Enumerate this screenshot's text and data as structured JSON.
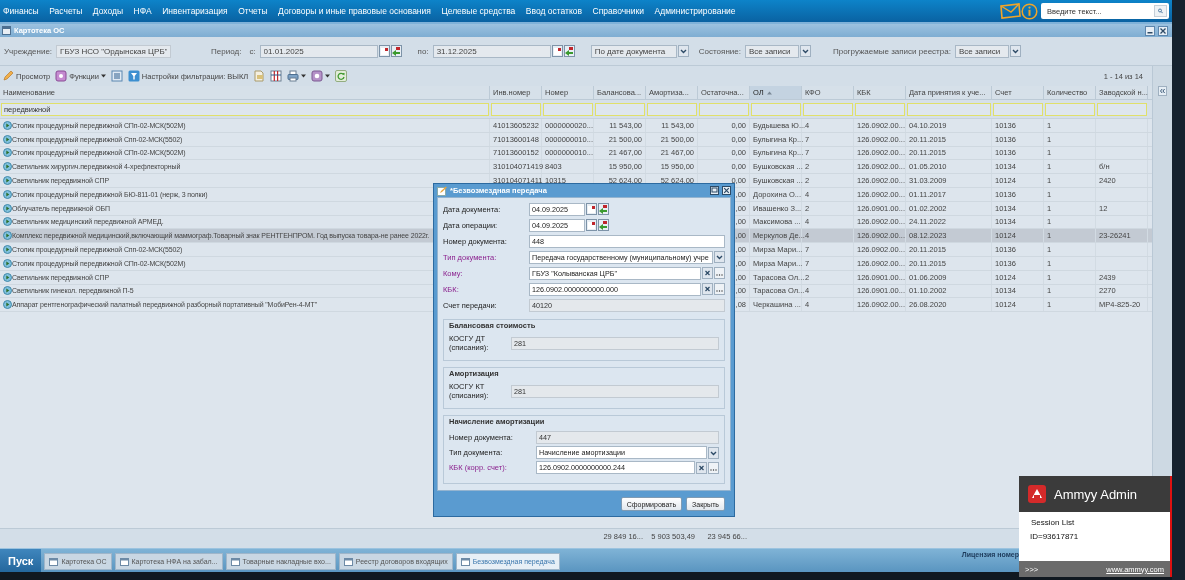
{
  "menu": {
    "items": [
      "Финансы",
      "Расчеты",
      "Доходы",
      "НФА",
      "Инвентаризация",
      "Отчеты",
      "Договоры и иные правовые основания",
      "Целевые средства",
      "Ввод остатков",
      "Справочники",
      "Администрирование"
    ],
    "search": {
      "placeholder": "Введите текст..."
    }
  },
  "window": {
    "title": "Картотека ОС"
  },
  "filter_bar": [
    {
      "kind": "label",
      "text": "Учреждение:"
    },
    {
      "kind": "text",
      "value": "ГБУЗ НСО \"Ордынская ЦРБ\""
    },
    {
      "kind": "label",
      "text": "Период:"
    },
    {
      "kind": "label",
      "text": "с:"
    },
    {
      "kind": "date",
      "value": "01.01.2025"
    },
    {
      "kind": "label",
      "text": "по:"
    },
    {
      "kind": "date",
      "value": "31.12.2025"
    },
    {
      "kind": "select",
      "value": "По дате документа"
    },
    {
      "kind": "label",
      "text": "Состояние:"
    },
    {
      "kind": "select",
      "value": "Все записи"
    },
    {
      "kind": "label",
      "text": "Прогружаемые записи реестра:"
    },
    {
      "kind": "select",
      "value": "Все записи"
    }
  ],
  "toolbar": {
    "items": [
      {
        "kind": "view",
        "label": "Просмотр",
        "menu": false
      },
      {
        "kind": "functions",
        "label": "Функции",
        "menu": true
      },
      {
        "kind": "list",
        "menu": false
      },
      {
        "kind": "filter",
        "label": "Настройки фильтрации: ВЫКЛ",
        "menu": false
      },
      {
        "kind": "export",
        "menu": false
      },
      {
        "kind": "columns",
        "menu": false
      },
      {
        "kind": "print",
        "menu": true
      },
      {
        "kind": "settings",
        "menu": true
      },
      {
        "kind": "refresh",
        "menu": false
      }
    ],
    "paging": "1 - 14 из 14"
  },
  "grid": {
    "columns": [
      {
        "title": "Наименование",
        "sorted": false,
        "filter": "передвижной"
      },
      {
        "title": "Инв.номер",
        "sorted": false
      },
      {
        "title": "Номер",
        "sorted": false
      },
      {
        "title": "Балансова...",
        "sorted": false
      },
      {
        "title": "Амортиза...",
        "sorted": false
      },
      {
        "title": "Остаточна...",
        "sorted": false
      },
      {
        "title": "ОЛ",
        "sorted": true
      },
      {
        "title": "КФО",
        "sorted": false
      },
      {
        "title": "КБК",
        "sorted": false
      },
      {
        "title": "Дата принятия к уче...",
        "sorted": false
      },
      {
        "title": "Счет",
        "sorted": false
      },
      {
        "title": "Количество",
        "sorted": false
      },
      {
        "title": "Заводской н...",
        "sorted": false
      }
    ],
    "rows": [
      {
        "selected": false,
        "name": "Столик процедурный передвижной СПп-02-МСК(502М)",
        "inv_number": "41013605232",
        "number": "0000000020...",
        "balance": "11 543,00",
        "amortization": "11 543,00",
        "residual": "0,00",
        "ol": "Будышева Ю...",
        "kfo": "4",
        "kbk": "126.0902.00...",
        "date": "04.10.2019",
        "account": "10136",
        "quantity": "1"
      },
      {
        "selected": false,
        "name": "Столик процедурный передвижной Спп-02-МСК(5502)",
        "inv_number": "71013600148",
        "number": "0000000010...",
        "balance": "21 500,00",
        "amortization": "21 500,00",
        "residual": "0,00",
        "ol": "Булыгина Кр...",
        "kfo": "7",
        "kbk": "126.0902.00...",
        "date": "20.11.2015",
        "account": "10136",
        "quantity": "1"
      },
      {
        "selected": false,
        "name": "Столик процедурный передвижной СПп-02-МСК(502М)",
        "inv_number": "71013600152",
        "number": "0000000010...",
        "balance": "21 467,00",
        "amortization": "21 467,00",
        "residual": "0,00",
        "ol": "Булыгина Кр...",
        "kfo": "7",
        "kbk": "126.0902.00...",
        "date": "20.11.2015",
        "account": "10136",
        "quantity": "1"
      },
      {
        "selected": false,
        "name": "Светильник хирургич.передвижной 4-хрефлекторный",
        "inv_number": "310104071419",
        "number": "8403",
        "balance": "15 950,00",
        "amortization": "15 950,00",
        "residual": "0,00",
        "ol": "Бушковская ...",
        "kfo": "2",
        "kbk": "126.0902.00...",
        "date": "01.05.2010",
        "account": "10134",
        "quantity": "1",
        "serial": "б/н"
      },
      {
        "selected": false,
        "name": "Светильник передвижной СПР",
        "inv_number": "310104071411",
        "number": "10315",
        "balance": "52 624,00",
        "amortization": "52 624,00",
        "residual": "0,00",
        "ol": "Бушковская ...",
        "kfo": "2",
        "kbk": "126.0902.00...",
        "date": "31.03.2009",
        "account": "10124",
        "quantity": "1",
        "serial": "2420"
      },
      {
        "selected": false,
        "name": "Столик процедурный передвижной БЮ-811-01 (нерж, 3 полки)",
        "residual": ",00",
        "ol": "Дорохина О...",
        "kfo": "4",
        "kbk": "126.0902.00...",
        "date": "01.11.2017",
        "account": "10136",
        "quantity": "1"
      },
      {
        "selected": false,
        "name": "Облучатель передвижной ОБП",
        "residual": ",00",
        "ol": "Ивашенко З...",
        "kfo": "2",
        "kbk": "126.0901.00...",
        "date": "01.02.2002",
        "account": "10134",
        "quantity": "1",
        "serial": "12"
      },
      {
        "selected": false,
        "name": "Светильник медицинский передвижной АРМЕД.",
        "residual": ",00",
        "ol": "Максимова ...",
        "kfo": "4",
        "kbk": "126.0902.00...",
        "date": "24.11.2022",
        "account": "10134",
        "quantity": "1"
      },
      {
        "selected": true,
        "name": "Комплекс передвижной медицинский,включающий маммограф.Товарный знак РЕНТГЕНПРОМ. Год выпуска товара-не ранее 2022г.",
        "residual": ",00",
        "ol": "Меркулов Де...",
        "kfo": "4",
        "kbk": "126.0902.00...",
        "date": "08.12.2023",
        "account": "10124",
        "quantity": "1",
        "serial": "23-26241"
      },
      {
        "selected": false,
        "name": "Столик процедурный передвижной Спп-02-МСК(5502)",
        "residual": ",00",
        "ol": "Мирза Мари...",
        "kfo": "7",
        "kbk": "126.0902.00...",
        "date": "20.11.2015",
        "account": "10136",
        "quantity": "1"
      },
      {
        "selected": false,
        "name": "Столик процедурный передвижной СПп-02-МСК(502М)",
        "residual": ",00",
        "ol": "Мирза Мари...",
        "kfo": "7",
        "kbk": "126.0902.00...",
        "date": "20.11.2015",
        "account": "10136",
        "quantity": "1"
      },
      {
        "selected": false,
        "name": "Светильник передвижной СПР",
        "residual": ",00",
        "ol": "Тарасова Ол...",
        "kfo": "2",
        "kbk": "126.0901.00...",
        "date": "01.06.2009",
        "account": "10124",
        "quantity": "1",
        "serial": "2439"
      },
      {
        "selected": false,
        "name": "Светильник гинекол. передвижной П-5",
        "residual": ",00",
        "ol": "Тарасова Ол...",
        "kfo": "4",
        "kbk": "126.0901.00...",
        "date": "01.10.2002",
        "account": "10134",
        "quantity": "1",
        "serial": "2270"
      },
      {
        "selected": false,
        "name": "Аппарат рентгенографический палатный передвижной разборный портативный \"МобиРен-4-МТ\"",
        "residual": ",08",
        "ol": "Черкашина ...",
        "kfo": "4",
        "kbk": "126.0902.00...",
        "date": "26.08.2020",
        "account": "10124",
        "quantity": "1",
        "serial": "МР4-825-20"
      }
    ],
    "totals": {
      "balance": "29 849 16...",
      "amortization": "5 903 503,49",
      "residual": "23 945 66..."
    }
  },
  "dialog": {
    "title": "*Безвозмездная передача",
    "fields": [
      {
        "kind": "date",
        "label": "Дата документа:",
        "value": "04.09.2025",
        "required": false
      },
      {
        "kind": "date",
        "label": "Дата операции:",
        "value": "04.09.2025",
        "required": false
      },
      {
        "kind": "text",
        "label": "Номер документа:",
        "value": "448",
        "required": false
      },
      {
        "kind": "select",
        "label": "Тип документа:",
        "value": "Передача государственному (муниципальному) учре",
        "required": true
      },
      {
        "kind": "lookup",
        "label": "Кому:",
        "value": "ГБУЗ \"Колыванская ЦРБ\"",
        "required": true
      },
      {
        "kind": "lookup",
        "label": "КБК:",
        "value": "126.0902.0000000000.000",
        "required": true
      },
      {
        "kind": "readonly",
        "label": "Счет передачи:",
        "value": "40120",
        "required": false
      }
    ],
    "sections": [
      {
        "title": "Балансовая стоимость",
        "fields": [
          {
            "kind": "readonly",
            "label": "КОСГУ ДТ (списания):",
            "value": "281",
            "required": false
          }
        ]
      },
      {
        "title": "Амортизация",
        "fields": [
          {
            "kind": "readonly",
            "label": "КОСГУ КТ (списания):",
            "value": "281",
            "required": false
          }
        ]
      },
      {
        "title": "Начисление амортизации",
        "fields": [
          {
            "kind": "readonly",
            "label": "Номер документа:",
            "value": "447",
            "required": false
          },
          {
            "kind": "select",
            "label": "Тип документа:",
            "value": "Начисление амортизации",
            "required": false
          },
          {
            "kind": "lookup",
            "label": "КБК (корр. счет):",
            "value": "126.0902.0000000000.244",
            "required": true
          }
        ]
      }
    ],
    "buttons": [
      "Сформировать",
      "Закрыть"
    ]
  },
  "taskbar": {
    "start": "Пуск",
    "tabs": [
      {
        "label": "Картотека ОС",
        "selected": false
      },
      {
        "label": "Картотека НФА на забал...",
        "selected": false
      },
      {
        "label": "Товарные накладные вхо...",
        "selected": false
      },
      {
        "label": "Реестр договоров входящих",
        "selected": false
      },
      {
        "label": "Безвозмездная передача",
        "selected": true
      }
    ],
    "license": "Лицензия номер"
  },
  "ammyy": {
    "title": "Ammyy Admin",
    "session_list": "Session List",
    "id": "ID=93617871",
    "more": ">>>",
    "link": "www.ammyy.com"
  }
}
